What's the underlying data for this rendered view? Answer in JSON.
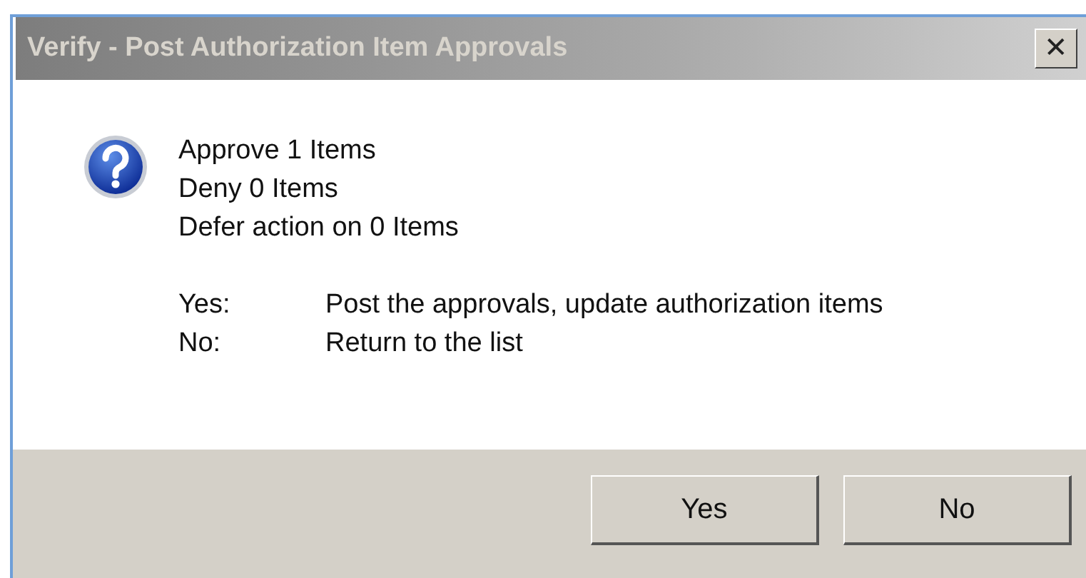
{
  "window": {
    "title": "Verify - Post Authorization Item Approvals",
    "close": "✕"
  },
  "summary": [
    "Approve 1 Items",
    "Deny 0 Items",
    "Defer action on 0 Items"
  ],
  "options": [
    {
      "key": "Yes:",
      "description": "Post the approvals, update authorization items"
    },
    {
      "key": "No:",
      "description": "Return to the list"
    }
  ],
  "buttons": [
    "Yes",
    "No"
  ]
}
